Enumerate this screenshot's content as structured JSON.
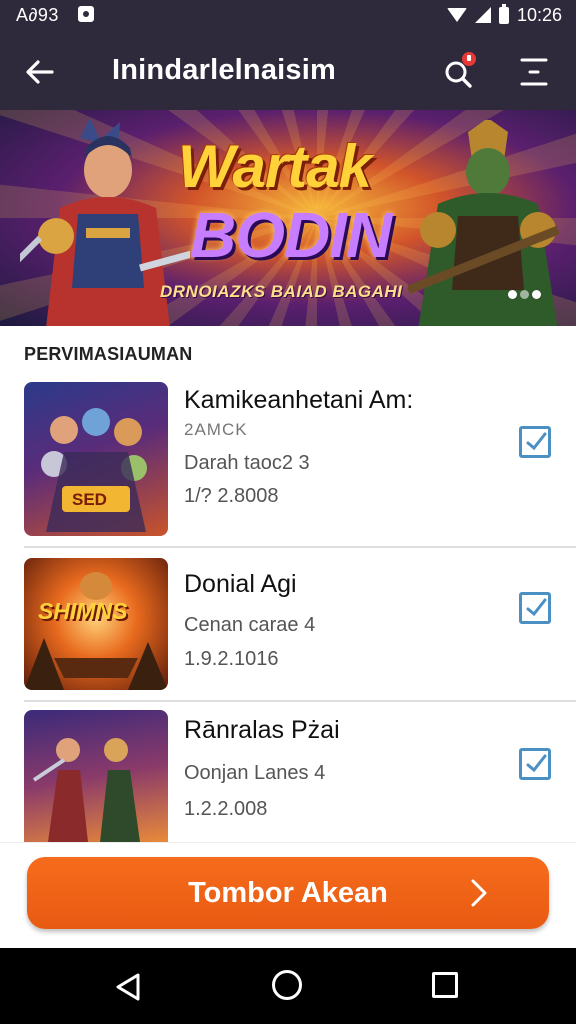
{
  "status_bar": {
    "time": "A∂93",
    "battery_pct": "10:26"
  },
  "app_bar": {
    "title": "Inindarlelnaisim"
  },
  "banner": {
    "title_line1": "Wartak",
    "title_line2": "BODIN",
    "subtitle": "DRNOIAZKS BAIAD BAGAHI"
  },
  "section_label": "PERVIMASIAUMAN",
  "items": [
    {
      "title": "Kamikeanhetani Am:",
      "subtitle": "2AMCK",
      "category": "Darah taoc2 3",
      "version": "1/? 2.8008",
      "checked": true,
      "thumb_text": "SED"
    },
    {
      "title": "Donial Agi",
      "subtitle": "",
      "category": "Cenan carae 4",
      "version": "1.9.2.1016",
      "checked": true,
      "thumb_text": "SHIMNS"
    },
    {
      "title": "Rānralas Pżai",
      "subtitle": "",
      "category": "Oonjan Lanes 4",
      "version": "1.2.2.008",
      "checked": true,
      "thumb_text": ""
    }
  ],
  "cta": {
    "label": "Tombor Akean"
  },
  "colors": {
    "app_bar": "#2f2a3b",
    "cta": "#f06418",
    "checkbox": "#4a90c2"
  }
}
